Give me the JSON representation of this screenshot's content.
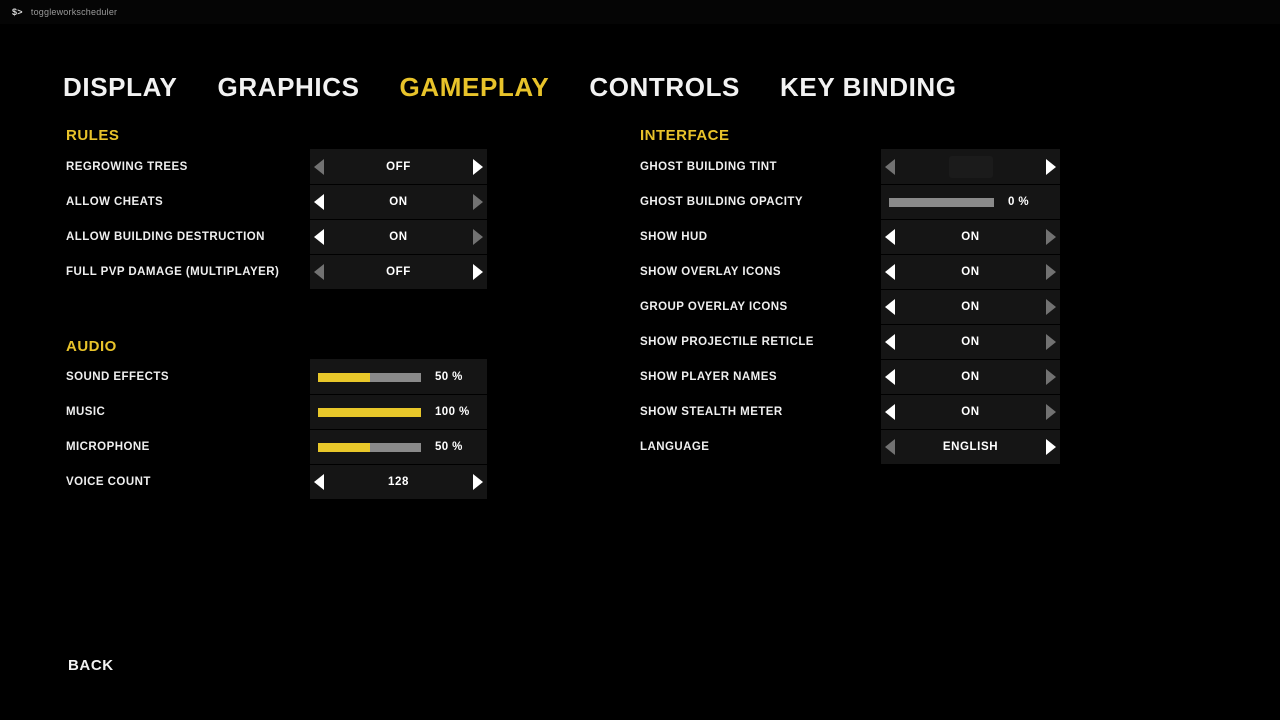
{
  "console": {
    "prompt": "$>",
    "command": "toggleworkscheduler"
  },
  "colors": {
    "accent": "#e8c32a",
    "panel_bg": "#151515",
    "page_bg": "#000000",
    "slider_fill": "#e8c72a",
    "slider_track": "#8a8a8a",
    "text": "#f2f2f2",
    "ghost_tint_swatch": "#1b1b1b"
  },
  "tabs": [
    {
      "label": "DISPLAY",
      "active": false
    },
    {
      "label": "GRAPHICS",
      "active": false
    },
    {
      "label": "GAMEPLAY",
      "active": true
    },
    {
      "label": "CONTROLS",
      "active": false
    },
    {
      "label": "KEY BINDING",
      "active": false
    }
  ],
  "sections": [
    {
      "id": "rules",
      "title": "RULES",
      "column": "left",
      "options": [
        {
          "label": "REGROWING TREES",
          "type": "selector",
          "value": "OFF",
          "left_arrow": "dim",
          "right_arrow": "bright"
        },
        {
          "label": "ALLOW CHEATS",
          "type": "selector",
          "value": "ON",
          "left_arrow": "bright",
          "right_arrow": "dim"
        },
        {
          "label": "ALLOW BUILDING DESTRUCTION",
          "type": "selector",
          "value": "ON",
          "left_arrow": "bright",
          "right_arrow": "dim"
        },
        {
          "label": "FULL PVP DAMAGE (MULTIPLAYER)",
          "type": "selector",
          "value": "OFF",
          "left_arrow": "dim",
          "right_arrow": "bright"
        }
      ]
    },
    {
      "id": "audio",
      "title": "AUDIO",
      "column": "left",
      "options": [
        {
          "label": "SOUND EFFECTS",
          "type": "slider",
          "value": "50 %",
          "percent": 50
        },
        {
          "label": "MUSIC",
          "type": "slider",
          "value": "100 %",
          "percent": 100
        },
        {
          "label": "MICROPHONE",
          "type": "slider",
          "value": "50 %",
          "percent": 50
        },
        {
          "label": "VOICE COUNT",
          "type": "selector",
          "value": "128",
          "left_arrow": "bright",
          "right_arrow": "bright"
        }
      ]
    },
    {
      "id": "interface",
      "title": "INTERFACE",
      "column": "right",
      "options": [
        {
          "label": "GHOST BUILDING TINT",
          "type": "swatch",
          "value": "",
          "swatch_color": "#1b1b1b",
          "left_arrow": "dim",
          "right_arrow": "bright"
        },
        {
          "label": "GHOST BUILDING OPACITY",
          "type": "slider",
          "value": "0 %",
          "percent": 0
        },
        {
          "label": "SHOW HUD",
          "type": "selector",
          "value": "ON",
          "left_arrow": "bright",
          "right_arrow": "dim"
        },
        {
          "label": "SHOW OVERLAY ICONS",
          "type": "selector",
          "value": "ON",
          "left_arrow": "bright",
          "right_arrow": "dim"
        },
        {
          "label": "GROUP OVERLAY ICONS",
          "type": "selector",
          "value": "ON",
          "left_arrow": "bright",
          "right_arrow": "dim"
        },
        {
          "label": "SHOW PROJECTILE RETICLE",
          "type": "selector",
          "value": "ON",
          "left_arrow": "bright",
          "right_arrow": "dim"
        },
        {
          "label": "SHOW PLAYER NAMES",
          "type": "selector",
          "value": "ON",
          "left_arrow": "bright",
          "right_arrow": "dim"
        },
        {
          "label": "SHOW STEALTH METER",
          "type": "selector",
          "value": "ON",
          "left_arrow": "bright",
          "right_arrow": "dim"
        },
        {
          "label": "LANGUAGE",
          "type": "selector",
          "value": "ENGLISH",
          "left_arrow": "dim",
          "right_arrow": "bright"
        }
      ]
    }
  ],
  "footer": {
    "back_label": "BACK"
  }
}
